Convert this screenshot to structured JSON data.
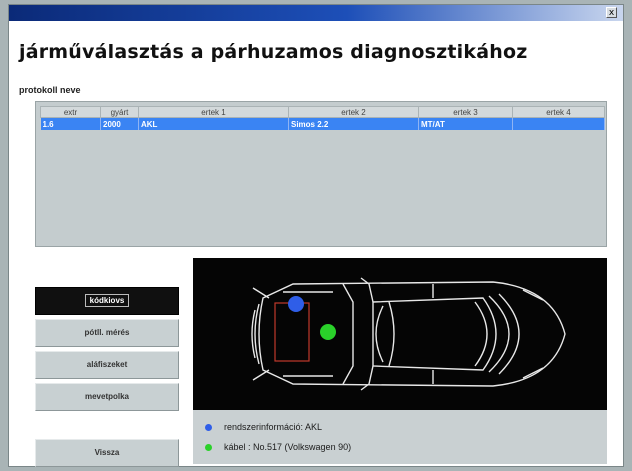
{
  "window": {
    "close_label": "x"
  },
  "header": {
    "title": "járműválasztás a párhuzamos diagnosztikához"
  },
  "protocol": {
    "label": "protokoll neve"
  },
  "table": {
    "columns": [
      "extr",
      "gyárt",
      "ertek 1",
      "ertek 2",
      "ertek 3",
      "ertek 4"
    ],
    "rows": [
      [
        "1.6",
        "2000",
        "AKL",
        "Simos 2.2",
        "MT/AT",
        ""
      ]
    ]
  },
  "sidebar": {
    "buttons": [
      {
        "label": "kódkiovs"
      },
      {
        "label": "pótll. mérés"
      },
      {
        "label": "aláfiszeket"
      },
      {
        "label": "mevetpolka"
      }
    ],
    "back_label": "Vissza"
  },
  "diagram": {
    "legend": [
      {
        "text": "rendszerinformáció: AKL",
        "color": "#2f5ee8"
      },
      {
        "text": "kábel : No.517 (Volkswagen 90)",
        "color": "#2ad12a"
      }
    ]
  },
  "colors": {
    "selected_row": "#3a84f3",
    "marker_blue": "#2f5ee8",
    "marker_green": "#2ad12a"
  }
}
